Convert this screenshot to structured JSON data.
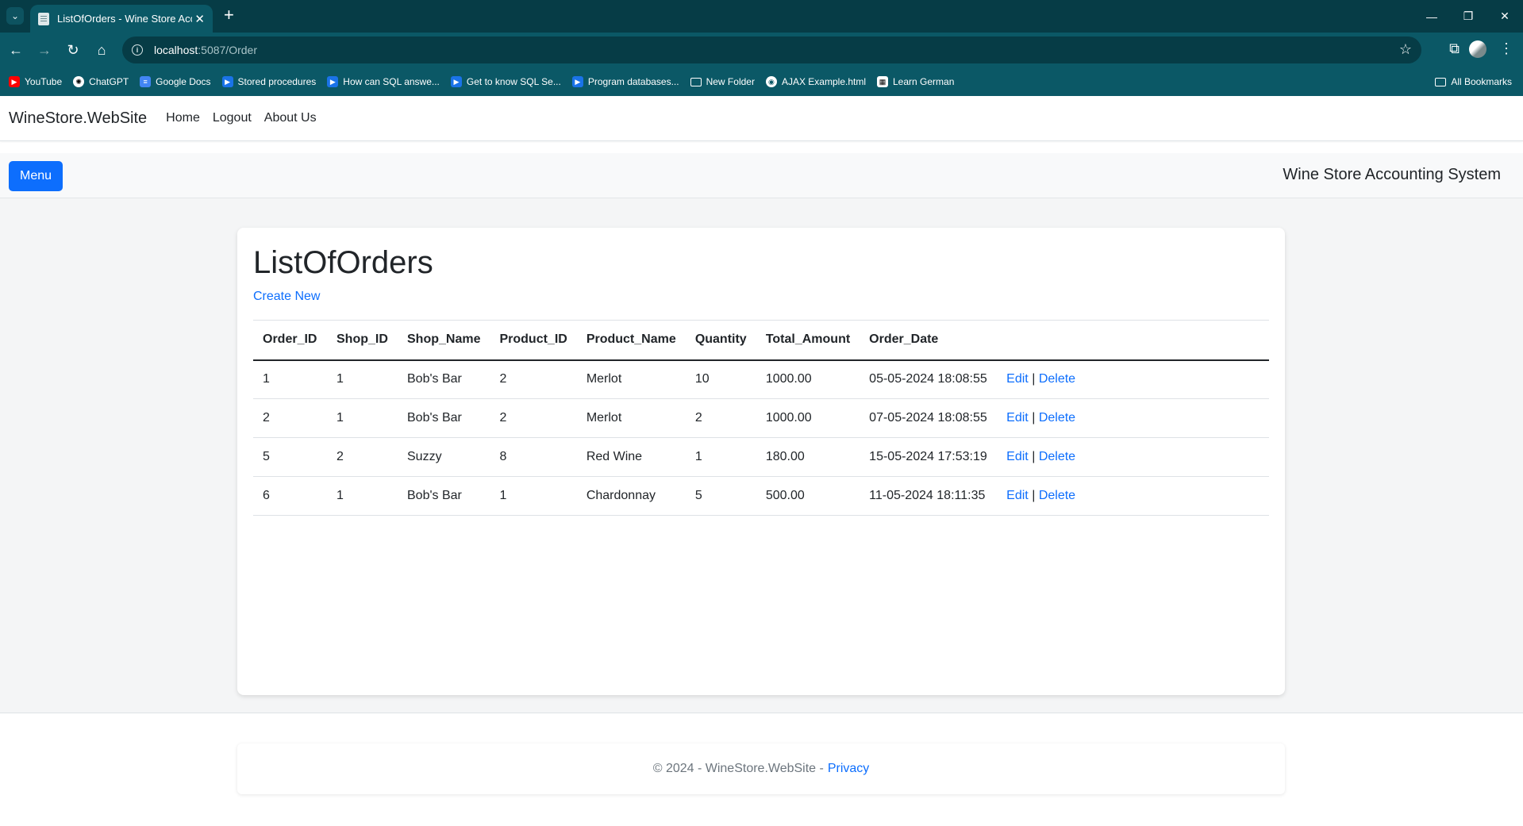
{
  "browser": {
    "tab_title": "ListOfOrders - Wine Store Acco",
    "url_host": "localhost",
    "url_path": ":5087/Order",
    "bookmarks": [
      {
        "label": "YouTube",
        "icon": "youtube-icon"
      },
      {
        "label": "ChatGPT",
        "icon": "chatgpt-icon"
      },
      {
        "label": "Google Docs",
        "icon": "google-docs-icon"
      },
      {
        "label": "Stored procedures",
        "icon": "play-icon"
      },
      {
        "label": "How can SQL answe...",
        "icon": "play-icon"
      },
      {
        "label": "Get to know SQL Se...",
        "icon": "play-icon"
      },
      {
        "label": "Program databases...",
        "icon": "play-icon"
      },
      {
        "label": "New Folder",
        "icon": "folder-icon"
      },
      {
        "label": "AJAX Example.html",
        "icon": "globe-icon"
      },
      {
        "label": "Learn German",
        "icon": "lg-icon"
      }
    ],
    "all_bookmarks": "All Bookmarks"
  },
  "navbar": {
    "brand": "WineStore.WebSite",
    "links": [
      "Home",
      "Logout",
      "About Us"
    ]
  },
  "subbar": {
    "menu_label": "Menu",
    "system_title": "Wine Store Accounting System"
  },
  "main": {
    "title": "ListOfOrders",
    "create_new": "Create New",
    "columns": [
      "Order_ID",
      "Shop_ID",
      "Shop_Name",
      "Product_ID",
      "Product_Name",
      "Quantity",
      "Total_Amount",
      "Order_Date"
    ],
    "rows": [
      {
        "order_id": "1",
        "shop_id": "1",
        "shop_name": "Bob's Bar",
        "product_id": "2",
        "product_name": "Merlot",
        "quantity": "10",
        "total_amount": "1000.00",
        "order_date": "05-05-2024 18:08:55"
      },
      {
        "order_id": "2",
        "shop_id": "1",
        "shop_name": "Bob's Bar",
        "product_id": "2",
        "product_name": "Merlot",
        "quantity": "2",
        "total_amount": "1000.00",
        "order_date": "07-05-2024 18:08:55"
      },
      {
        "order_id": "5",
        "shop_id": "2",
        "shop_name": "Suzzy",
        "product_id": "8",
        "product_name": "Red Wine",
        "quantity": "1",
        "total_amount": "180.00",
        "order_date": "15-05-2024 17:53:19"
      },
      {
        "order_id": "6",
        "shop_id": "1",
        "shop_name": "Bob's Bar",
        "product_id": "1",
        "product_name": "Chardonnay",
        "quantity": "5",
        "total_amount": "500.00",
        "order_date": "11-05-2024 18:11:35"
      }
    ],
    "edit_label": "Edit",
    "delete_label": "Delete",
    "separator": "|"
  },
  "footer": {
    "text": "© 2024 - WineStore.WebSite -",
    "privacy_label": "Privacy"
  }
}
